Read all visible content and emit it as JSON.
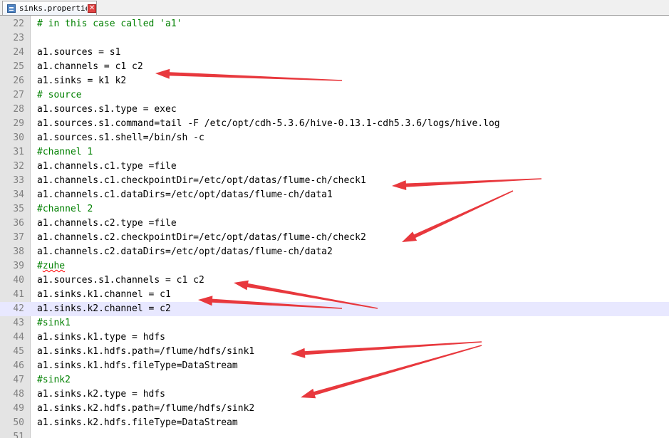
{
  "tab": {
    "filename": "sinks.properties",
    "icon": "document-icon",
    "close_glyph": "✕"
  },
  "editor": {
    "current_line": 42,
    "arrow_color": "#e8383d",
    "lines": [
      {
        "num": "22",
        "text": "# in this case called 'a1'",
        "comment": true
      },
      {
        "num": "23",
        "text": "",
        "comment": false
      },
      {
        "num": "24",
        "text": "a1.sources = s1",
        "comment": false
      },
      {
        "num": "25",
        "text": "a1.channels = c1 c2",
        "comment": false
      },
      {
        "num": "26",
        "text": "a1.sinks = k1 k2",
        "comment": false
      },
      {
        "num": "27",
        "text": "# source",
        "comment": true
      },
      {
        "num": "28",
        "text": "a1.sources.s1.type = exec",
        "comment": false
      },
      {
        "num": "29",
        "text": "a1.sources.s1.command=tail -F /etc/opt/cdh-5.3.6/hive-0.13.1-cdh5.3.6/logs/hive.log",
        "comment": false
      },
      {
        "num": "30",
        "text": "a1.sources.s1.shell=/bin/sh -c",
        "comment": false
      },
      {
        "num": "31",
        "text": "#channel 1",
        "comment": true
      },
      {
        "num": "32",
        "text": "a1.channels.c1.type =file",
        "comment": false
      },
      {
        "num": "33",
        "text": "a1.channels.c1.checkpointDir=/etc/opt/datas/flume-ch/check1",
        "comment": false
      },
      {
        "num": "34",
        "text": "a1.channels.c1.dataDirs=/etc/opt/datas/flume-ch/data1",
        "comment": false
      },
      {
        "num": "35",
        "text": "#channel 2",
        "comment": true
      },
      {
        "num": "36",
        "text": "a1.channels.c2.type =file",
        "comment": false
      },
      {
        "num": "37",
        "text": "a1.channels.c2.checkpointDir=/etc/opt/datas/flume-ch/check2",
        "comment": false
      },
      {
        "num": "38",
        "text": "a1.channels.c2.dataDirs=/etc/opt/datas/flume-ch/data2",
        "comment": false
      },
      {
        "num": "39",
        "text": "#",
        "comment": true,
        "spell": "zuhe"
      },
      {
        "num": "40",
        "text": "a1.sources.s1.channels = c1 c2",
        "comment": false
      },
      {
        "num": "41",
        "text": "a1.sinks.k1.channel = c1",
        "comment": false
      },
      {
        "num": "42",
        "text": "a1.sinks.k2.channel = c2",
        "comment": false
      },
      {
        "num": "43",
        "text": "#sink1",
        "comment": true
      },
      {
        "num": "44",
        "text": "a1.sinks.k1.type = hdfs",
        "comment": false
      },
      {
        "num": "45",
        "text": "a1.sinks.k1.hdfs.path=/flume/hdfs/sink1",
        "comment": false
      },
      {
        "num": "46",
        "text": "a1.sinks.k1.hdfs.fileType=DataStream",
        "comment": false
      },
      {
        "num": "47",
        "text": "#sink2",
        "comment": true
      },
      {
        "num": "48",
        "text": "a1.sinks.k2.type = hdfs",
        "comment": false
      },
      {
        "num": "49",
        "text": "a1.sinks.k2.hdfs.path=/flume/hdfs/sink2",
        "comment": false
      },
      {
        "num": "50",
        "text": "a1.sinks.k2.hdfs.fileType=DataStream",
        "comment": false
      },
      {
        "num": "51",
        "text": "",
        "comment": false
      }
    ]
  }
}
